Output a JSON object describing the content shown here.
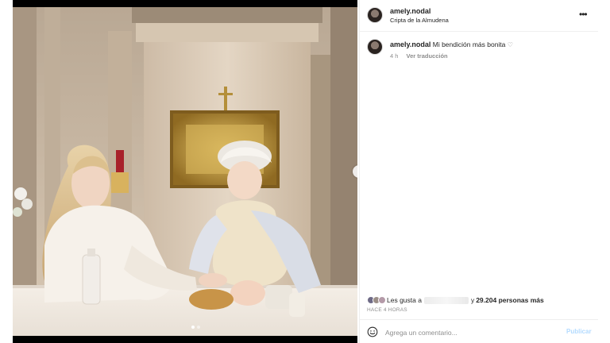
{
  "post": {
    "username": "amely.nodal",
    "location": "Cripta de la Almudena",
    "more_icon": "more-horizontal-icon"
  },
  "caption": {
    "username": "amely.nodal",
    "text": "Mi bendición más bonita",
    "heart": "♡",
    "time": "4 h",
    "translate_label": "Ver traducción"
  },
  "likes": {
    "prefix": "Les gusta a",
    "suffix_pre": "y",
    "count": "29.204 personas más",
    "avatar_colors": [
      "#6e6a86",
      "#9b8f88",
      "#b49aa8"
    ]
  },
  "time_ago": "HACE 4 HORAS",
  "comment": {
    "placeholder": "Agrega un comentario...",
    "publish_label": "Publicar",
    "emoji_icon": "smiley-icon"
  },
  "carousel": {
    "next_icon": "chevron-right-icon",
    "next_glyph": "›",
    "dot_count": 2,
    "active_index": 0
  },
  "colors": {
    "publish_disabled": "#b3dbff",
    "secondary_text": "#8e8e8e",
    "border": "#efefef"
  }
}
